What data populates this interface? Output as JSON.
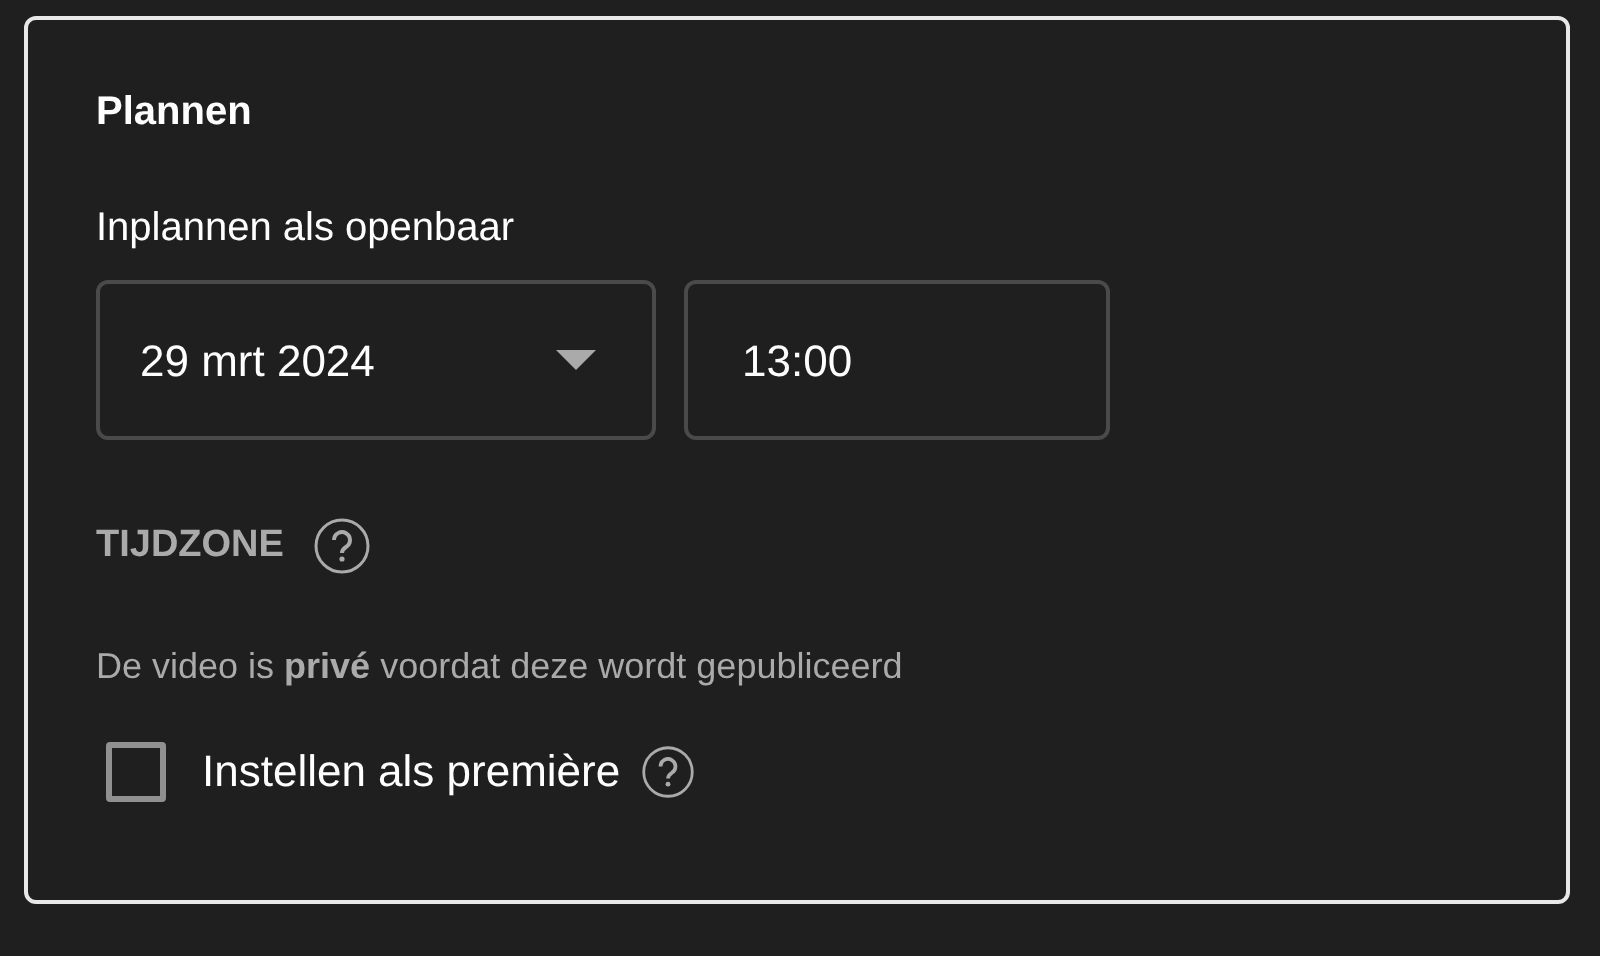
{
  "card": {
    "title": "Plannen",
    "subtitle": "Inplannen als openbaar",
    "date_field": {
      "value": "29 mrt 2024"
    },
    "time_field": {
      "value": "13:00"
    },
    "timezone_label": "TIJDZONE",
    "notice": "De video is **privé** voordat deze wordt gepubliceerd",
    "premiere": {
      "label": "Instellen als première",
      "checked": false
    }
  }
}
